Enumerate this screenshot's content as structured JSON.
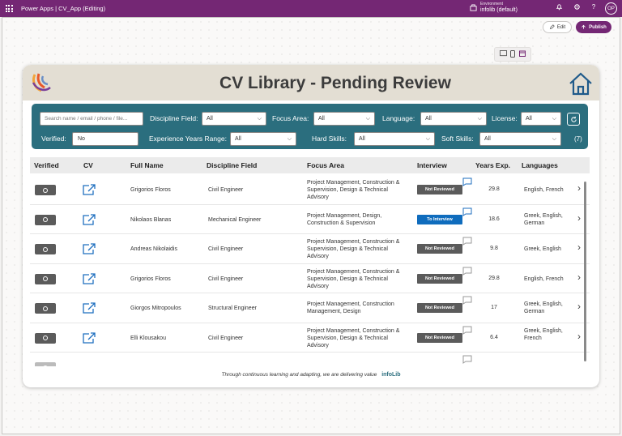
{
  "topbar": {
    "app_title": "Power Apps  |  CV_App (Editing)",
    "environment_label": "Environment",
    "environment_name": "infolib (default)",
    "avatar_initials": "OP",
    "color": "#742774"
  },
  "studio": {
    "edit_label": "Edit",
    "publish_label": "Publish"
  },
  "header": {
    "title": "CV Library - Pending Review"
  },
  "filters": {
    "search_placeholder": "Search name / email / phone / file...",
    "discipline_label": "Discipline Field:",
    "discipline_value": "All",
    "focus_label": "Focus Area:",
    "focus_value": "All",
    "language_label": "Language:",
    "language_value": "All",
    "license_label": "License:",
    "license_value": "All",
    "verified_label": "Verified:",
    "verified_value": "No",
    "experience_label": "Experience Years Range:",
    "experience_value": "All",
    "hard_label": "Hard Skills:",
    "hard_value": "All",
    "soft_label": "Soft Skills:",
    "soft_value": "All",
    "count": "(7)",
    "panel_color": "#2b6e7e"
  },
  "table": {
    "headers": {
      "verified": "Verified",
      "cv": "CV",
      "full_name": "Full Name",
      "discipline": "Discipline Field",
      "focus": "Focus Area",
      "interview": "Interview",
      "years": "Years Exp.",
      "languages": "Languages"
    },
    "rows": [
      {
        "name": "Grigorios Floros",
        "discipline": "Civil Engineer",
        "focus": "Project Management, Construction & Supervision, Design & Technical Advisory",
        "interview": "Not Reviewed",
        "years": "29.8",
        "languages": "English, French"
      },
      {
        "name": "Nikolaos Blanas",
        "discipline": "Mechanical Engineer",
        "focus": "Project Management, Design, Construction & Supervision",
        "interview": "To Interview",
        "years": "18.6",
        "languages": "Greek, English, German"
      },
      {
        "name": "Andreas Nikolaidis",
        "discipline": "Civil Engineer",
        "focus": "Project Management, Construction & Supervision, Design & Technical Advisory",
        "interview": "Not Reviewed",
        "years": "9.8",
        "languages": "Greek, English"
      },
      {
        "name": "Grigorios Floros",
        "discipline": "Civil Engineer",
        "focus": "Project Management, Construction & Supervision, Design & Technical Advisory",
        "interview": "Not Reviewed",
        "years": "29.8",
        "languages": "English, French"
      },
      {
        "name": "Giorgos Mitropoulos",
        "discipline": "Structural Engineer",
        "focus": "Project Management, Construction Management, Design",
        "interview": "Not Reviewed",
        "years": "17",
        "languages": "Greek, English, German"
      },
      {
        "name": "Elli Klousakou",
        "discipline": "Civil Engineer",
        "focus": "Project Management, Construction & Supervision, Design & Technical Advisory",
        "interview": "Not Reviewed",
        "years": "6.4",
        "languages": "Greek, English, French"
      }
    ]
  },
  "footer": {
    "tagline": "Through continuous learning and adapting, we are delivering value",
    "brand": "infoLib"
  }
}
